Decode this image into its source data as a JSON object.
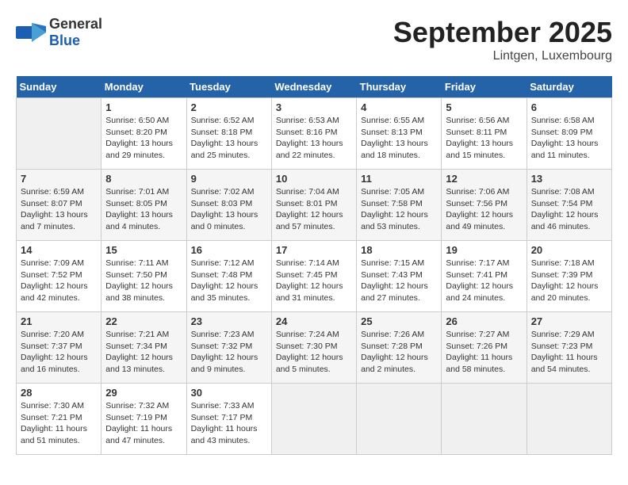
{
  "header": {
    "logo_line1": "General",
    "logo_line2": "Blue",
    "month": "September 2025",
    "location": "Lintgen, Luxembourg"
  },
  "days_of_week": [
    "Sunday",
    "Monday",
    "Tuesday",
    "Wednesday",
    "Thursday",
    "Friday",
    "Saturday"
  ],
  "weeks": [
    [
      {
        "day": "",
        "empty": true
      },
      {
        "day": "1",
        "sunrise": "6:50 AM",
        "sunset": "8:20 PM",
        "daylight": "13 hours and 29 minutes."
      },
      {
        "day": "2",
        "sunrise": "6:52 AM",
        "sunset": "8:18 PM",
        "daylight": "13 hours and 25 minutes."
      },
      {
        "day": "3",
        "sunrise": "6:53 AM",
        "sunset": "8:16 PM",
        "daylight": "13 hours and 22 minutes."
      },
      {
        "day": "4",
        "sunrise": "6:55 AM",
        "sunset": "8:13 PM",
        "daylight": "13 hours and 18 minutes."
      },
      {
        "day": "5",
        "sunrise": "6:56 AM",
        "sunset": "8:11 PM",
        "daylight": "13 hours and 15 minutes."
      },
      {
        "day": "6",
        "sunrise": "6:58 AM",
        "sunset": "8:09 PM",
        "daylight": "13 hours and 11 minutes."
      }
    ],
    [
      {
        "day": "7",
        "sunrise": "6:59 AM",
        "sunset": "8:07 PM",
        "daylight": "13 hours and 7 minutes."
      },
      {
        "day": "8",
        "sunrise": "7:01 AM",
        "sunset": "8:05 PM",
        "daylight": "13 hours and 4 minutes."
      },
      {
        "day": "9",
        "sunrise": "7:02 AM",
        "sunset": "8:03 PM",
        "daylight": "13 hours and 0 minutes."
      },
      {
        "day": "10",
        "sunrise": "7:04 AM",
        "sunset": "8:01 PM",
        "daylight": "12 hours and 57 minutes."
      },
      {
        "day": "11",
        "sunrise": "7:05 AM",
        "sunset": "7:58 PM",
        "daylight": "12 hours and 53 minutes."
      },
      {
        "day": "12",
        "sunrise": "7:06 AM",
        "sunset": "7:56 PM",
        "daylight": "12 hours and 49 minutes."
      },
      {
        "day": "13",
        "sunrise": "7:08 AM",
        "sunset": "7:54 PM",
        "daylight": "12 hours and 46 minutes."
      }
    ],
    [
      {
        "day": "14",
        "sunrise": "7:09 AM",
        "sunset": "7:52 PM",
        "daylight": "12 hours and 42 minutes."
      },
      {
        "day": "15",
        "sunrise": "7:11 AM",
        "sunset": "7:50 PM",
        "daylight": "12 hours and 38 minutes."
      },
      {
        "day": "16",
        "sunrise": "7:12 AM",
        "sunset": "7:48 PM",
        "daylight": "12 hours and 35 minutes."
      },
      {
        "day": "17",
        "sunrise": "7:14 AM",
        "sunset": "7:45 PM",
        "daylight": "12 hours and 31 minutes."
      },
      {
        "day": "18",
        "sunrise": "7:15 AM",
        "sunset": "7:43 PM",
        "daylight": "12 hours and 27 minutes."
      },
      {
        "day": "19",
        "sunrise": "7:17 AM",
        "sunset": "7:41 PM",
        "daylight": "12 hours and 24 minutes."
      },
      {
        "day": "20",
        "sunrise": "7:18 AM",
        "sunset": "7:39 PM",
        "daylight": "12 hours and 20 minutes."
      }
    ],
    [
      {
        "day": "21",
        "sunrise": "7:20 AM",
        "sunset": "7:37 PM",
        "daylight": "12 hours and 16 minutes."
      },
      {
        "day": "22",
        "sunrise": "7:21 AM",
        "sunset": "7:34 PM",
        "daylight": "12 hours and 13 minutes."
      },
      {
        "day": "23",
        "sunrise": "7:23 AM",
        "sunset": "7:32 PM",
        "daylight": "12 hours and 9 minutes."
      },
      {
        "day": "24",
        "sunrise": "7:24 AM",
        "sunset": "7:30 PM",
        "daylight": "12 hours and 5 minutes."
      },
      {
        "day": "25",
        "sunrise": "7:26 AM",
        "sunset": "7:28 PM",
        "daylight": "12 hours and 2 minutes."
      },
      {
        "day": "26",
        "sunrise": "7:27 AM",
        "sunset": "7:26 PM",
        "daylight": "11 hours and 58 minutes."
      },
      {
        "day": "27",
        "sunrise": "7:29 AM",
        "sunset": "7:23 PM",
        "daylight": "11 hours and 54 minutes."
      }
    ],
    [
      {
        "day": "28",
        "sunrise": "7:30 AM",
        "sunset": "7:21 PM",
        "daylight": "11 hours and 51 minutes."
      },
      {
        "day": "29",
        "sunrise": "7:32 AM",
        "sunset": "7:19 PM",
        "daylight": "11 hours and 47 minutes."
      },
      {
        "day": "30",
        "sunrise": "7:33 AM",
        "sunset": "7:17 PM",
        "daylight": "11 hours and 43 minutes."
      },
      {
        "day": "",
        "empty": true
      },
      {
        "day": "",
        "empty": true
      },
      {
        "day": "",
        "empty": true
      },
      {
        "day": "",
        "empty": true
      }
    ]
  ]
}
